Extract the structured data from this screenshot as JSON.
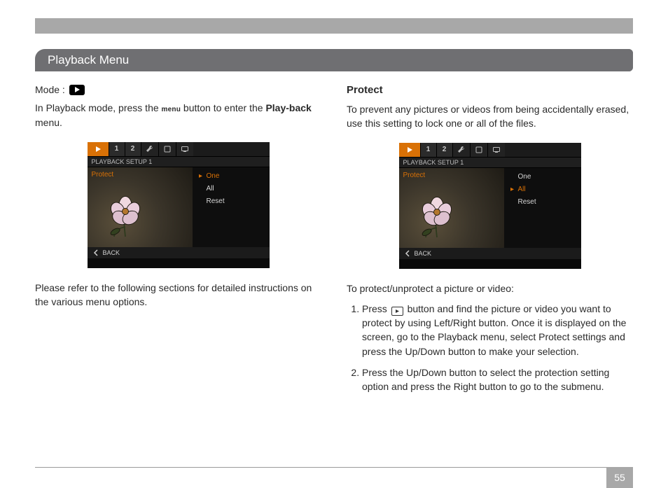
{
  "header": {
    "title": "Playback Menu"
  },
  "left": {
    "modeLabel": "Mode :",
    "intro_a": "In Playback mode, press the ",
    "menuWord": "menu",
    "intro_b": " button to enter the ",
    "intro_bold": "Play-back",
    "intro_c": " menu.",
    "note": "Please refer to the following sections for detailed instructions on the various menu options."
  },
  "right": {
    "heading": "Protect",
    "desc": "To prevent any pictures or videos from being accidentally erased, use this setting to lock one or all of the files.",
    "lead": "To protect/unprotect a picture or video:",
    "steps": [
      "Press   button and find the picture or video you want to protect by using Left/Right button.  Once it is displayed on the screen, go to the Playback menu, select Protect settings and press the Up/Down button to make your selection.",
      "Press the Up/Down button to select the protection setting option and press the Right button to go to the submenu."
    ],
    "step1_a": "Press ",
    "step1_b": " button and find the picture or video you want to protect by using Left/Right button.  Once it is displayed on the screen, go to the Playback menu, select Protect settings and press the Up/Down button to make your selection."
  },
  "camera": {
    "subtitle": "PLAYBACK  SETUP  1",
    "leftLabel": "Protect",
    "options": [
      "One",
      "All",
      "Reset"
    ],
    "back": "BACK",
    "tabs": {
      "one": "1",
      "two": "2"
    }
  },
  "cam1": {
    "selectedIndex": 0
  },
  "cam2": {
    "selectedIndex": 1
  },
  "page": {
    "number": "55"
  }
}
